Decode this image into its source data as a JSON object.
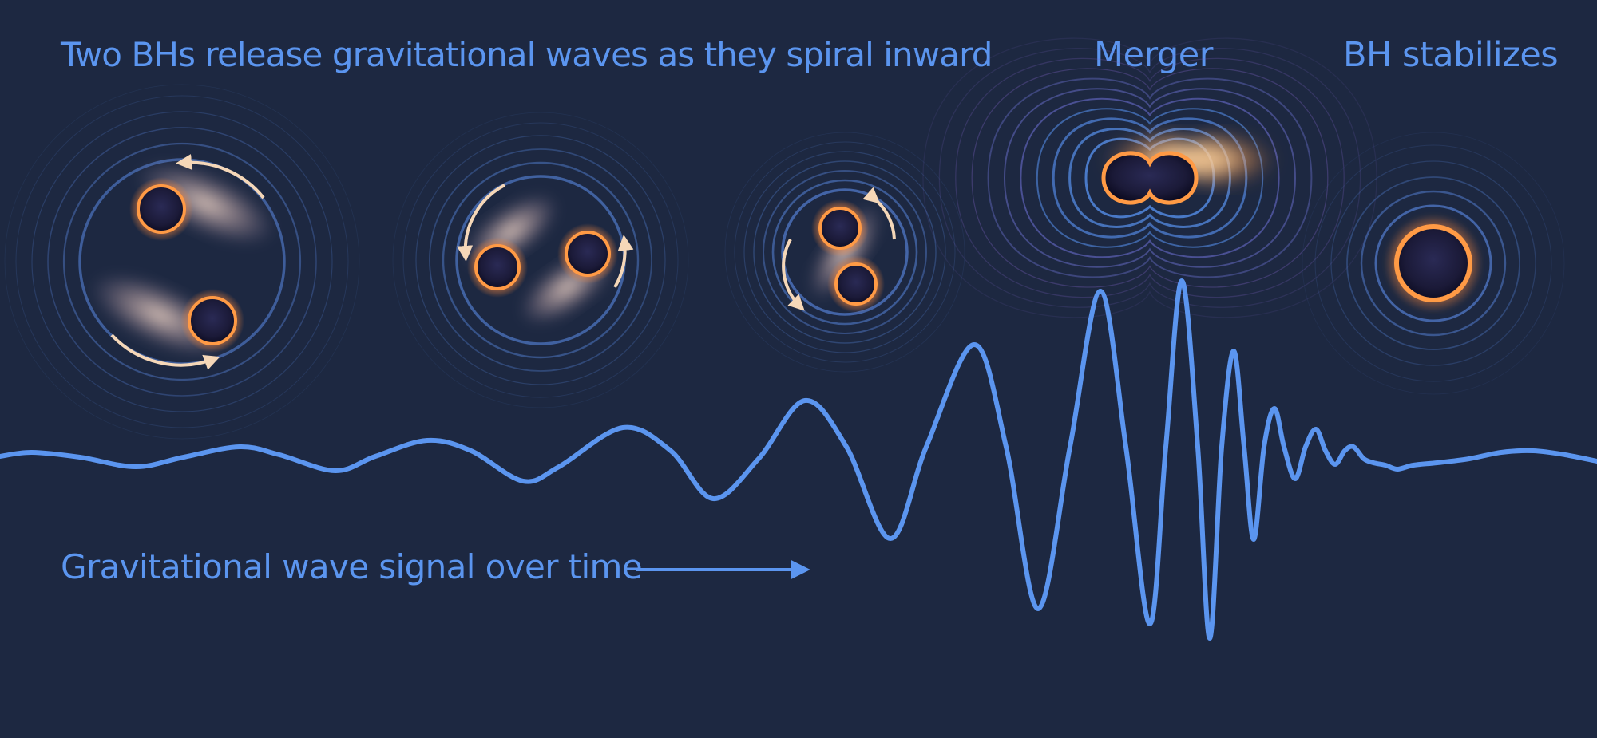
{
  "labels": {
    "inspiral": "Two BHs release gravitational waves as they spiral inward",
    "merger": "Merger",
    "ringdown": "BH stabilizes",
    "signal": "Gravitational wave signal over time"
  },
  "colors": {
    "background": "#1d2841",
    "accent_blue": "#5b95ef",
    "ring_blue": "#4a74c4",
    "ring_purple": "#7767c9",
    "bh_rim_orange": "#ff9a45",
    "bh_glow": "#ffcf96",
    "bh_core": "#1c1b3a",
    "orbit_arrow": "#f5d7b8"
  },
  "icons": [
    "black-hole-icon",
    "orbit-arrow-icon",
    "signal-arrow-icon"
  ]
}
